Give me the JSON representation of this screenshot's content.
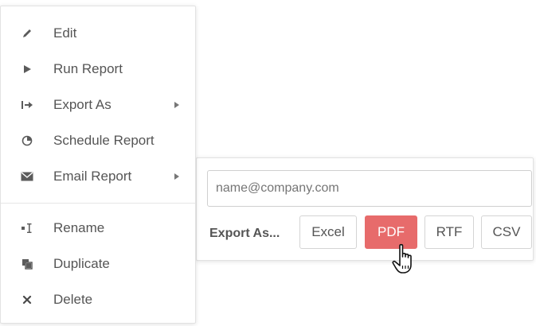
{
  "context_menu": {
    "items": [
      {
        "label": "Edit",
        "icon": "pencil-icon"
      },
      {
        "label": "Run Report",
        "icon": "play-icon"
      },
      {
        "label": "Export As",
        "icon": "export-icon",
        "has_submenu": true
      },
      {
        "label": "Schedule Report",
        "icon": "clock-pie-icon"
      },
      {
        "label": "Email Report",
        "icon": "envelope-icon",
        "has_submenu": true
      },
      {
        "label": "Rename",
        "icon": "rename-cursor-icon"
      },
      {
        "label": "Duplicate",
        "icon": "duplicate-icon"
      },
      {
        "label": "Delete",
        "icon": "x-icon"
      }
    ]
  },
  "export_panel": {
    "email_placeholder": "name@company.com",
    "export_label": "Export As...",
    "formats": [
      {
        "label": "Excel",
        "active": false
      },
      {
        "label": "PDF",
        "active": true
      },
      {
        "label": "RTF",
        "active": false
      },
      {
        "label": "CSV",
        "active": false
      }
    ]
  },
  "colors": {
    "text": "#555555",
    "border": "#d4d4d4",
    "pdf_active_bg": "#e76b6b",
    "pdf_active_text": "#ffffff"
  },
  "cursor": "hand-pointer-icon"
}
